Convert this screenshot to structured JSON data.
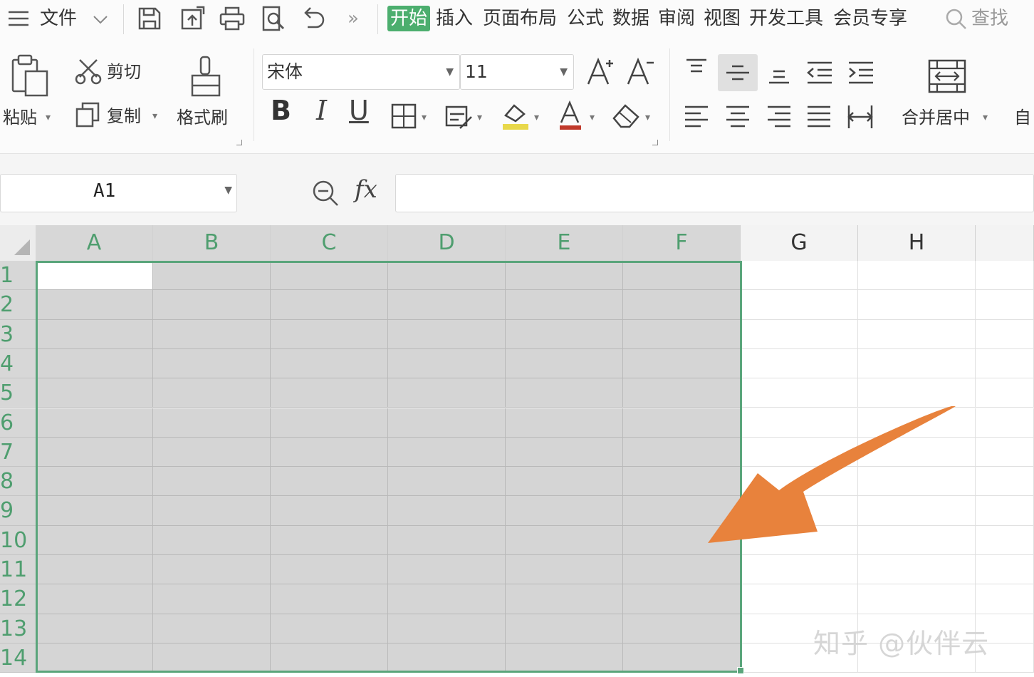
{
  "menubar": {
    "file_label": "文件",
    "tabs": [
      "开始",
      "插入",
      "页面布局",
      "公式",
      "数据",
      "审阅",
      "视图",
      "开发工具",
      "会员专享"
    ],
    "active_tab": "开始",
    "more_glyph": "»",
    "search_label": "查找"
  },
  "ribbon": {
    "paste_label": "粘贴",
    "cut_label": "剪切",
    "copy_label": "复制",
    "format_painter_label": "格式刷",
    "font_name": "宋体",
    "font_size": "11",
    "bold": "B",
    "italic": "I",
    "underline": "U",
    "merge_center_label": "合并居中",
    "wrap_label_partial": "自"
  },
  "formula_bar": {
    "name_box": "A1",
    "fx_label": "fx",
    "formula": ""
  },
  "sheet": {
    "columns": [
      "A",
      "B",
      "C",
      "D",
      "E",
      "F",
      "G",
      "H"
    ],
    "rows": [
      "1",
      "2",
      "3",
      "4",
      "5",
      "6",
      "7",
      "8",
      "9",
      "10",
      "11",
      "12",
      "13",
      "14"
    ],
    "selected_range": "A1:F14",
    "active_cell": "A1"
  },
  "colors": {
    "accent": "#4cae6e",
    "selection_border": "#5aa57b",
    "selection_fill": "#d5d5d5",
    "annotation_arrow": "#e8823c"
  },
  "watermark": "知乎 @伙伴云"
}
